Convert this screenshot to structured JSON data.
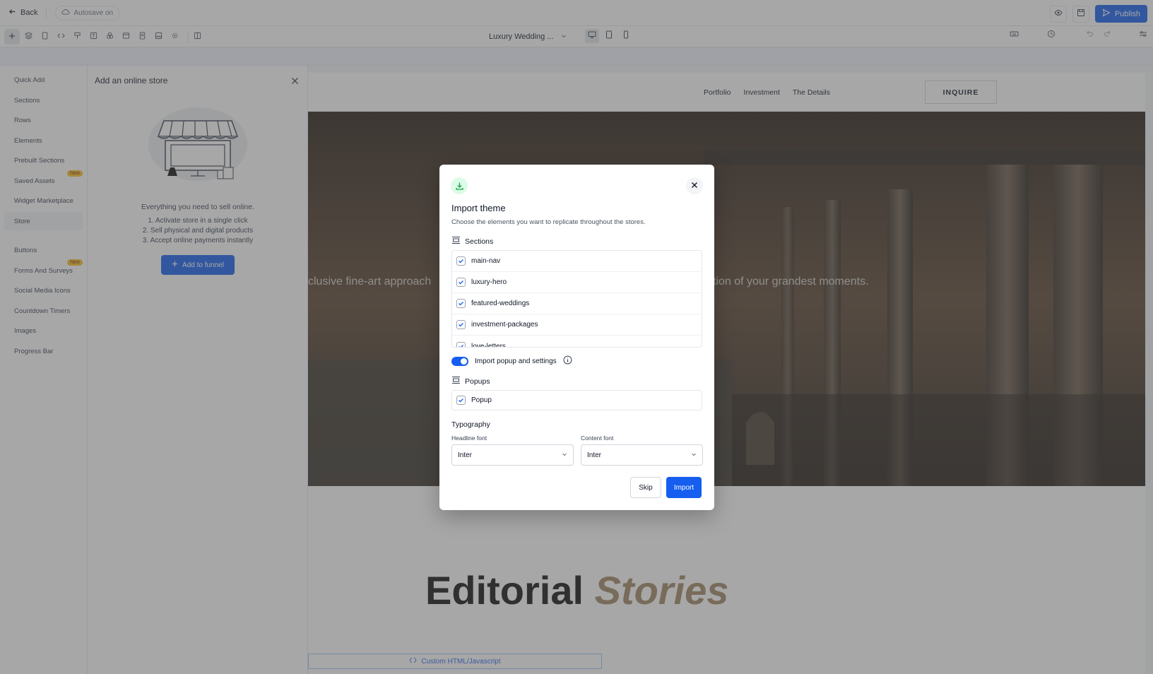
{
  "topbar": {
    "back_label": "Back",
    "autosave_label": "Autosave on",
    "publish_label": "Publish"
  },
  "toolbar": {
    "page_name": "Luxury Wedding ..."
  },
  "strip": {
    "text": ""
  },
  "leftnav": {
    "items": [
      {
        "label": "Quick Add"
      },
      {
        "label": "Sections"
      },
      {
        "label": "Rows"
      },
      {
        "label": "Elements"
      },
      {
        "label": "Prebuilt Sections"
      },
      {
        "label": "Saved Assets",
        "badge": "New"
      },
      {
        "label": "Widget Marketplace"
      },
      {
        "label": "Store"
      },
      {
        "label": "Buttons"
      },
      {
        "label": "Forms And Surveys",
        "badge": "New"
      },
      {
        "label": "Social Media Icons"
      },
      {
        "label": "Countdown Timers"
      },
      {
        "label": "Images"
      },
      {
        "label": "Progress Bar"
      }
    ]
  },
  "store_panel": {
    "title": "Add an online store",
    "tagline": "Everything you need to sell online.",
    "steps": [
      "1. Activate store in a single click",
      "2. Sell physical and digital products",
      "3. Accept online payments instantly"
    ],
    "add_button": "Add to funnel"
  },
  "site": {
    "nav_links": [
      "Portfolio",
      "Investment",
      "The Details"
    ],
    "cta": "INQUIRE",
    "hero_text_left": "clusive fine-art approach",
    "hero_text_right": "tion of your grandest moments.",
    "editorial_word": "Editorial",
    "editorial_accent": "Stories",
    "custom_html_label": "Custom HTML/Javascript"
  },
  "modal": {
    "title": "Import theme",
    "subtitle": "Choose the elements you want to replicate throughout the stores.",
    "sections_heading": "Sections",
    "sections": [
      {
        "name": "main-nav",
        "checked": true
      },
      {
        "name": "luxury-hero",
        "checked": true
      },
      {
        "name": "featured-weddings",
        "checked": true
      },
      {
        "name": "investment-packages",
        "checked": true
      },
      {
        "name": "love-letters",
        "checked": true
      }
    ],
    "toggle_label": "Import popup and settings",
    "toggle_on": true,
    "popups_heading": "Popups",
    "popups": [
      {
        "name": "Popup",
        "checked": true
      }
    ],
    "typography_heading": "Typography",
    "headline_font_label": "Headline font",
    "headline_font": "Inter",
    "content_font_label": "Content font",
    "content_font": "Inter",
    "skip_label": "Skip",
    "import_label": "Import"
  },
  "colors": {
    "accent": "#155eef",
    "editorial_accent": "#a08664",
    "success_icon_bg": "#dcfce7",
    "badge": "#fbbf24"
  }
}
